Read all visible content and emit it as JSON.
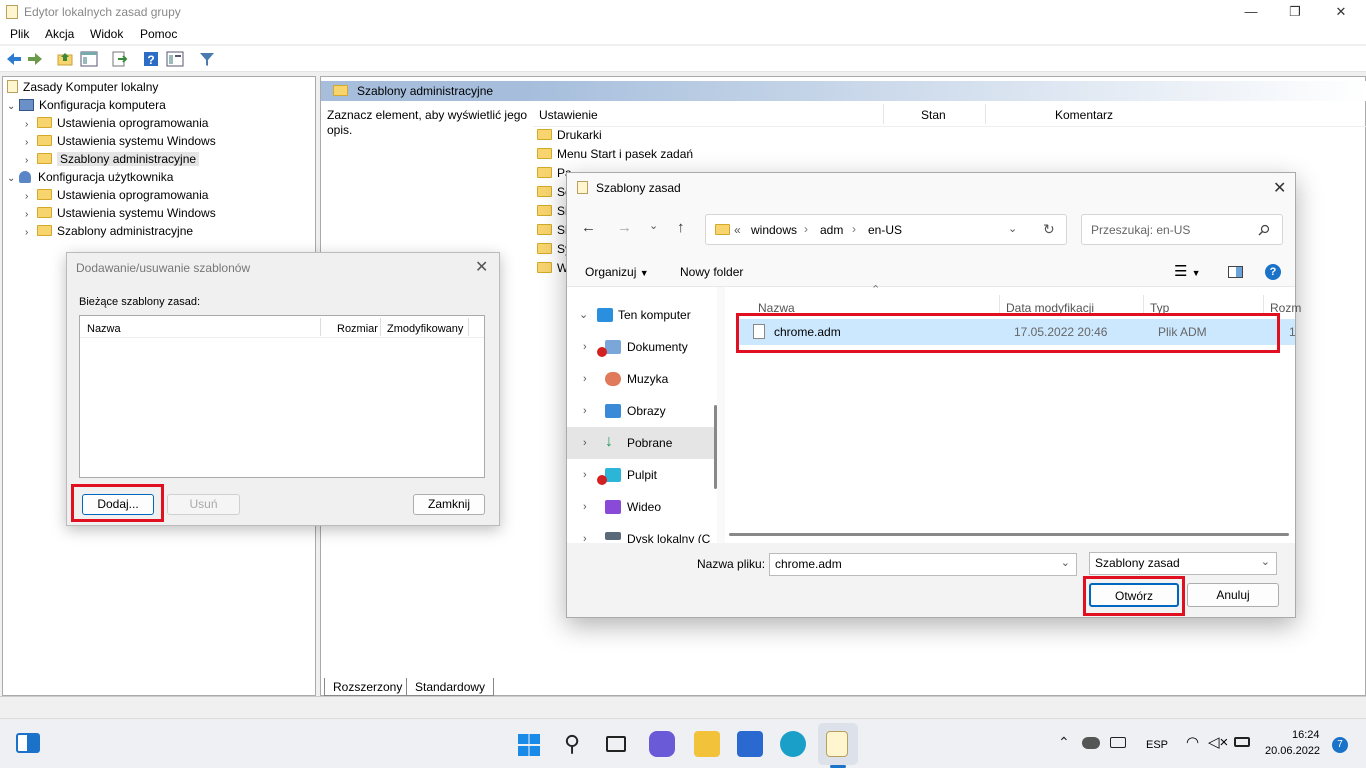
{
  "app": {
    "title": "Edytor lokalnych zasad grupy"
  },
  "menu": [
    "Plik",
    "Akcja",
    "Widok",
    "Pomoc"
  ],
  "tree": {
    "root": "Zasady Komputer lokalny",
    "computer": "Konfiguracja komputera",
    "computer_children": [
      "Ustawienia oprogramowania",
      "Ustawienia systemu Windows",
      "Szablony administracyjne"
    ],
    "user": "Konfiguracja użytkownika",
    "user_children": [
      "Ustawienia oprogramowania",
      "Ustawienia systemu Windows",
      "Szablony administracyjne"
    ]
  },
  "right": {
    "header": "Szablony administracyjne",
    "hint": "Zaznacz element, aby wyświetlić jego opis.",
    "columns": [
      "Ustawienie",
      "Stan",
      "Komentarz"
    ],
    "items": [
      "Drukarki",
      "Menu Start i pasek zadań",
      "Pa",
      "Se",
      "Sie",
      "Sk",
      "Sy",
      "W"
    ]
  },
  "tabs": [
    "Rozszerzony",
    "Standardowy"
  ],
  "addremove": {
    "title": "Dodawanie/usuwanie szablonów",
    "label": "Bieżące szablony zasad:",
    "columns": [
      "Nazwa",
      "Rozmiar",
      "Zmodyfikowany"
    ],
    "add": "Dodaj...",
    "remove": "Usuń",
    "close": "Zamknij"
  },
  "filedlg": {
    "title": "Szablony zasad",
    "path_prefix": "«",
    "path": [
      "windows",
      "adm",
      "en-US"
    ],
    "search_placeholder": "Przeszukaj: en-US",
    "organize": "Organizuj",
    "new_folder": "Nowy folder",
    "nav": [
      {
        "label": "Ten komputer",
        "icon": "pc-icon"
      },
      {
        "label": "Dokumenty",
        "icon": "documents-icon"
      },
      {
        "label": "Muzyka",
        "icon": "music-icon"
      },
      {
        "label": "Obrazy",
        "icon": "pictures-icon"
      },
      {
        "label": "Pobrane",
        "icon": "downloads-icon"
      },
      {
        "label": "Pulpit",
        "icon": "desktop-icon"
      },
      {
        "label": "Wideo",
        "icon": "video-icon"
      },
      {
        "label": "Dysk lokalny (C",
        "icon": "drive-icon"
      }
    ],
    "columns": [
      "Nazwa",
      "Data modyfikacji",
      "Typ",
      "Rozm"
    ],
    "file": {
      "name": "chrome.adm",
      "date": "17.05.2022 20:46",
      "type": "Plik ADM",
      "size": "1"
    },
    "filename_label": "Nazwa pliku:",
    "filename": "chrome.adm",
    "filter": "Szablony zasad",
    "open": "Otwórz",
    "cancel": "Anuluj"
  },
  "taskbar": {
    "lang": "ESP",
    "time": "16:24",
    "date": "20.06.2022",
    "notifications": "7"
  },
  "colors": {
    "accent": "#0067c0",
    "highlight": "#cce8ff",
    "red": "#e01020"
  }
}
